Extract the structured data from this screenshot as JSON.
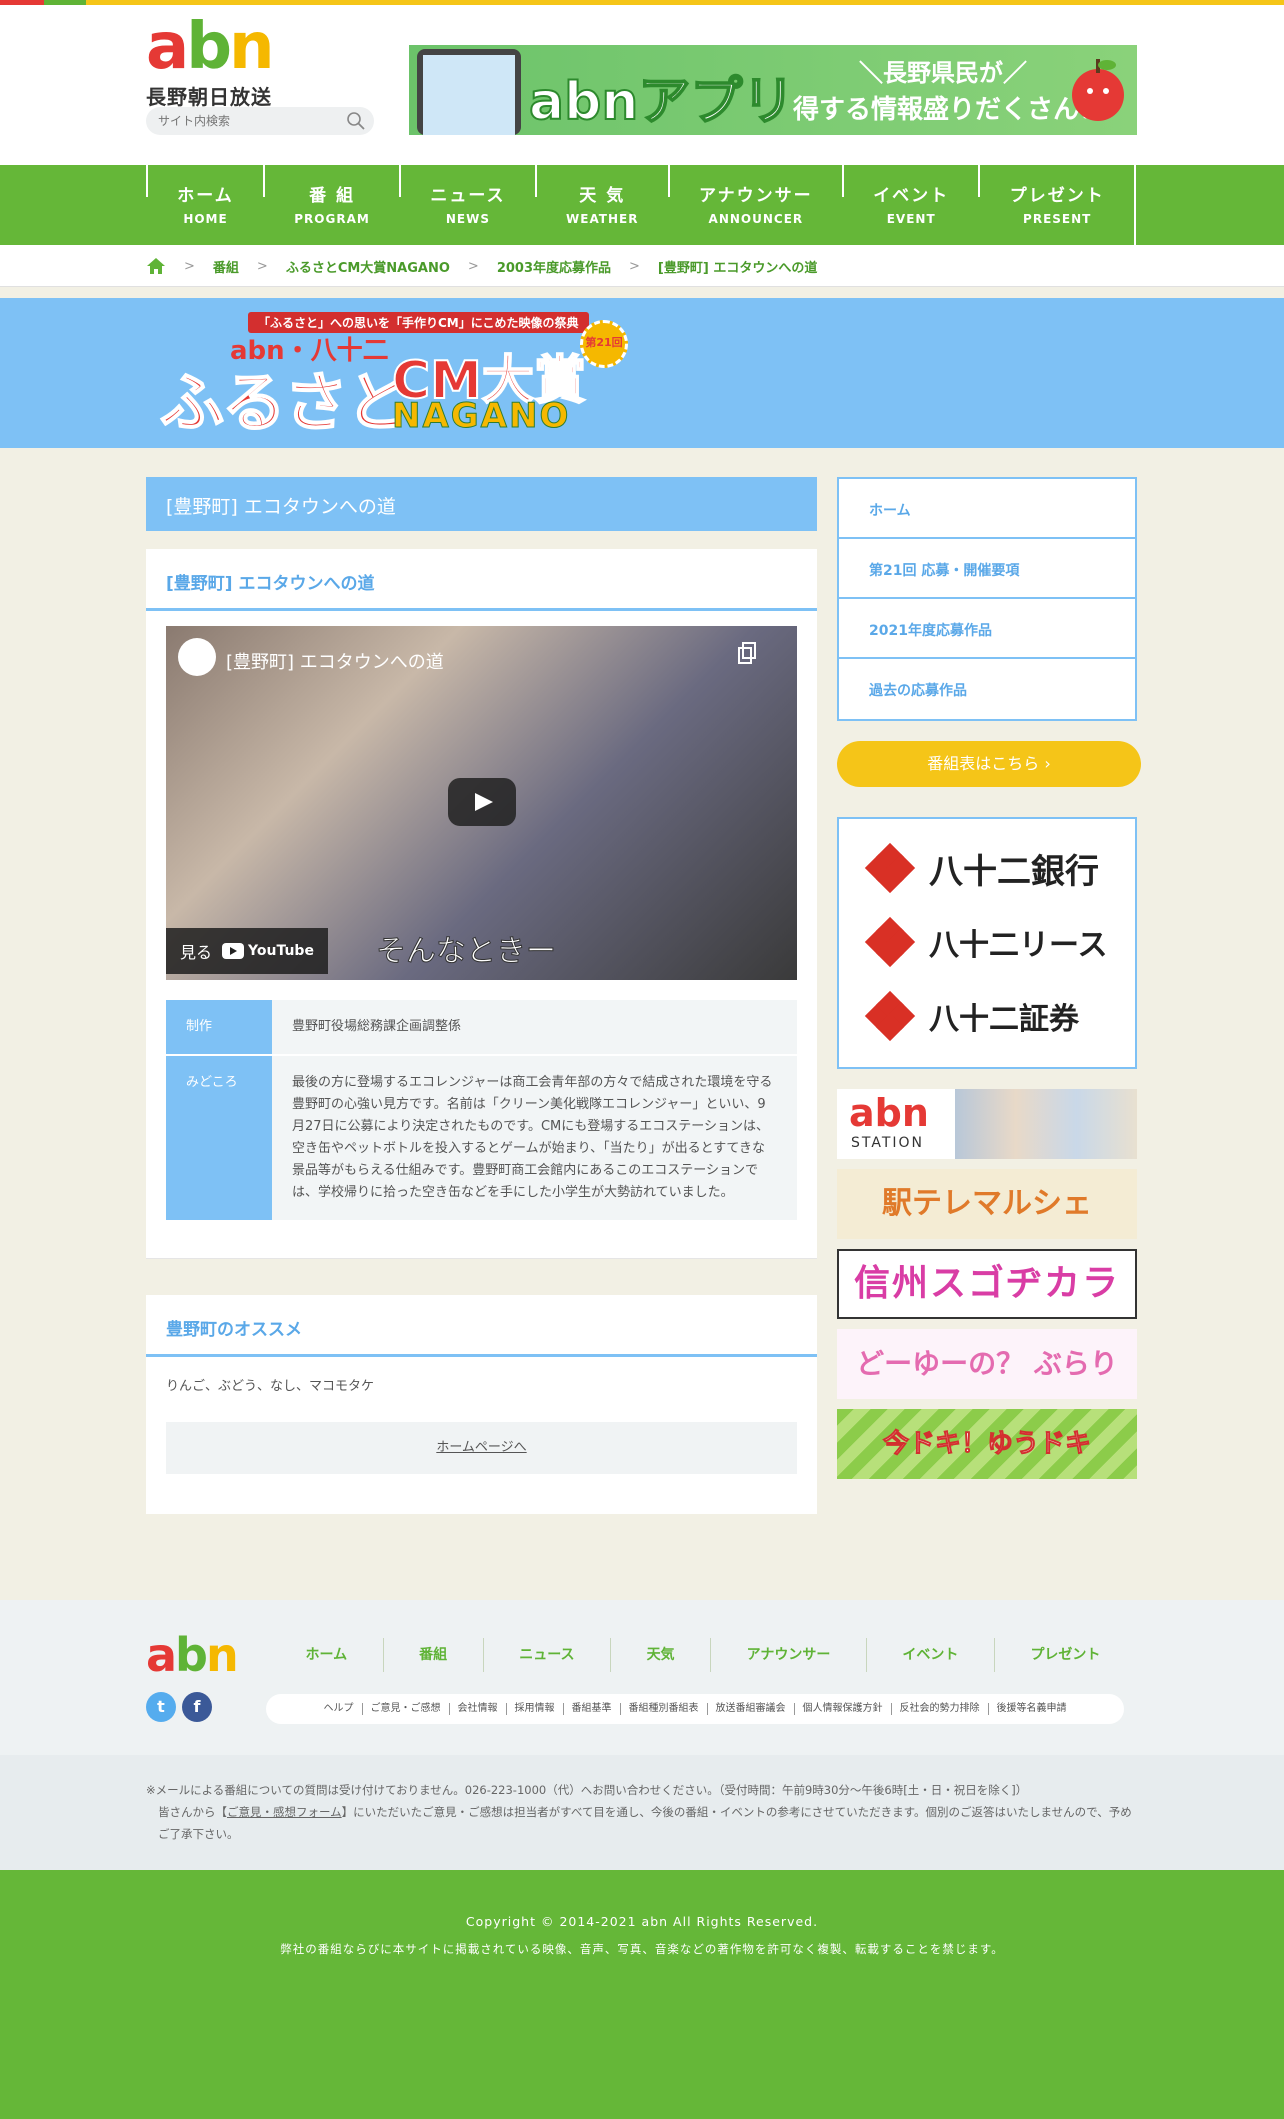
{
  "header": {
    "logo_text": {
      "a": "a",
      "b": "b",
      "n": "n"
    },
    "logo_sub": "長野朝日放送",
    "search_placeholder": "サイト内検索",
    "app_banner": {
      "title": "abnアプリ",
      "copy_line1": "＼長野県民が／",
      "copy_line2": "得する情報盛りだくさん！"
    }
  },
  "nav": {
    "items": [
      {
        "jp": "ホーム",
        "en": "HOME"
      },
      {
        "jp": "番 組",
        "en": "PROGRAM"
      },
      {
        "jp": "ニュース",
        "en": "NEWS"
      },
      {
        "jp": "天 気",
        "en": "WEATHER"
      },
      {
        "jp": "アナウンサー",
        "en": "ANNOUNCER"
      },
      {
        "jp": "イベント",
        "en": "EVENT"
      },
      {
        "jp": "プレゼント",
        "en": "PRESENT"
      }
    ]
  },
  "breadcrumb": {
    "items": [
      "番組",
      "ふるさとCM大賞NAGANO",
      "2003年度応募作品",
      "[豊野町] エコタウンへの道"
    ],
    "separator": ">"
  },
  "hero": {
    "tagline": "「ふるさと」への思いを「手作りCM」にこめた映像の祭典",
    "brand": "abn・八十二",
    "furusato": "ふるさと",
    "cm": "CM大賞",
    "nagano": "NAGANO",
    "badge": "第21回"
  },
  "main": {
    "page_title": "[豊野町] エコタウンへの道",
    "card_title": "[豊野町] エコタウンへの道",
    "video": {
      "title": "[豊野町] エコタウンへの道",
      "watch_label": "見る",
      "youtube_label": "YouTube",
      "caption": "そんなときー"
    },
    "info": {
      "producer_label": "制作",
      "producer_value": "豊野町役場総務課企画調整係",
      "highlight_label": "みどころ",
      "highlight_value": "最後の方に登場するエコレンジャーは商工会青年部の方々で結成された環境を守る豊野町の心強い見方です。名前は「クリーン美化戦隊エコレンジャー」といい、9月27日に公募により決定されたものです。CMにも登場するエコステーションは、空き缶やペットボトルを投入するとゲームが始まり、「当たり」が出るとすてきな景品等がもらえる仕組みです。豊野町商工会館内にあるこのエコステーションでは、学校帰りに拾った空き缶などを手にした小学生が大勢訪れていました。"
    },
    "recommend_title": "豊野町のオススメ",
    "recommend_text": "りんご、ぶどう、なし、マコモタケ",
    "homepage_link": "ホームページへ"
  },
  "sidebar": {
    "menu": [
      "ホーム",
      "第21回 応募・開催要項",
      "2021年度応募作品",
      "過去の応募作品"
    ],
    "schedule_button": "番組表はこちら ›",
    "sponsors": [
      "八十二銀行",
      "八十二リース",
      "八十二証券"
    ],
    "banners": {
      "station_logo": "abn",
      "station_sub": "STATION",
      "eki": "駅テレマルシェ",
      "sugo": "信州スゴヂカラ",
      "doyu": "どーゆーの？ ぶらり",
      "ima": "今ドキ！ゆうドキ"
    }
  },
  "footer": {
    "nav": [
      "ホーム",
      "番組",
      "ニュース",
      "天気",
      "アナウンサー",
      "イベント",
      "プレゼント"
    ],
    "links": [
      "ヘルプ",
      "ご意見・ご感想",
      "会社情報",
      "採用情報",
      "番組基準",
      "番組種別番組表",
      "放送番組審議会",
      "個人情報保護方針",
      "反社会的勢力排除",
      "後援等名義申請"
    ],
    "notice1": "※メールによる番組についての質問は受け付けておりません。026-223-1000（代）へお問い合わせください。（受付時間：午前9時30分〜午後6時[土・日・祝日を除く]）",
    "notice2_pre": "皆さんから【",
    "notice2_link": "ご意見・感想フォーム",
    "notice2_post": "】にいただいたご意見・ご感想は担当者がすべて目を通し、今後の番組・イベントの参考にさせていただきます。個別のご返答はいたしませんので、予めご了承下さい。",
    "copyright": "Copyright © 2014-2021 abn All Rights Reserved.",
    "copyright_note": "弊社の番組ならびに本サイトに掲載されている映像、音声、写真、音楽などの著作物を許可なく複製、転載することを禁じます。"
  },
  "colors": {
    "green": "#65b738",
    "blue": "#7ec1f5",
    "yellow": "#f5c518",
    "red": "#e53935"
  }
}
